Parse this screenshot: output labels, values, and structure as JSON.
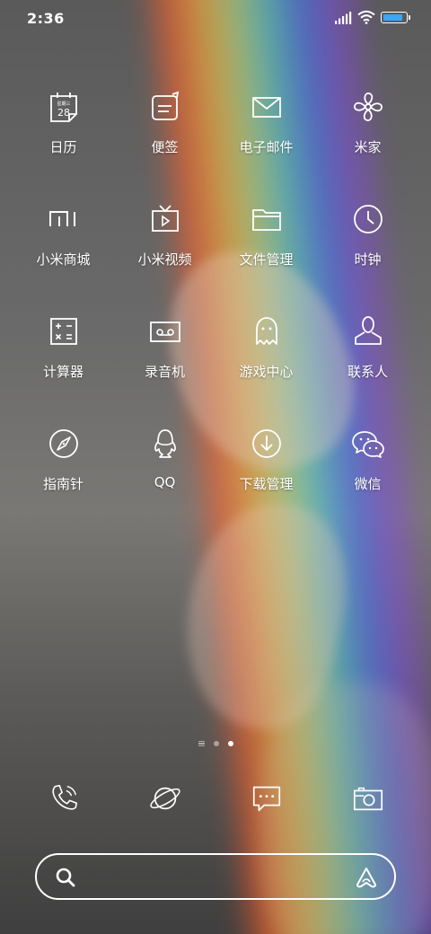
{
  "status_bar": {
    "time": "2:36",
    "battery_level": 0.9,
    "accent_color": "#38a7ff"
  },
  "apps": [
    {
      "label": "日历",
      "icon": "calendar-icon",
      "calendar_weekday": "星期三",
      "calendar_day": "28"
    },
    {
      "label": "便签",
      "icon": "notes-icon"
    },
    {
      "label": "电子邮件",
      "icon": "mail-icon"
    },
    {
      "label": "米家",
      "icon": "mijia-fan-icon"
    },
    {
      "label": "小米商城",
      "icon": "mi-logo-icon"
    },
    {
      "label": "小米视频",
      "icon": "tv-icon"
    },
    {
      "label": "文件管理",
      "icon": "folder-icon"
    },
    {
      "label": "时钟",
      "icon": "clock-icon"
    },
    {
      "label": "计算器",
      "icon": "calculator-icon"
    },
    {
      "label": "录音机",
      "icon": "recorder-icon"
    },
    {
      "label": "游戏中心",
      "icon": "ghost-icon"
    },
    {
      "label": "联系人",
      "icon": "contact-icon"
    },
    {
      "label": "指南针",
      "icon": "compass-icon"
    },
    {
      "label": "QQ",
      "icon": "qq-penguin-icon"
    },
    {
      "label": "下载管理",
      "icon": "download-icon"
    },
    {
      "label": "微信",
      "icon": "wechat-icon"
    }
  ],
  "page_indicator": {
    "current_page": 2,
    "total_pages": 2
  },
  "dock": [
    {
      "icon": "phone-icon"
    },
    {
      "icon": "browser-planet-icon"
    },
    {
      "icon": "message-icon"
    },
    {
      "icon": "camera-icon"
    }
  ],
  "search": {
    "placeholder": ""
  }
}
